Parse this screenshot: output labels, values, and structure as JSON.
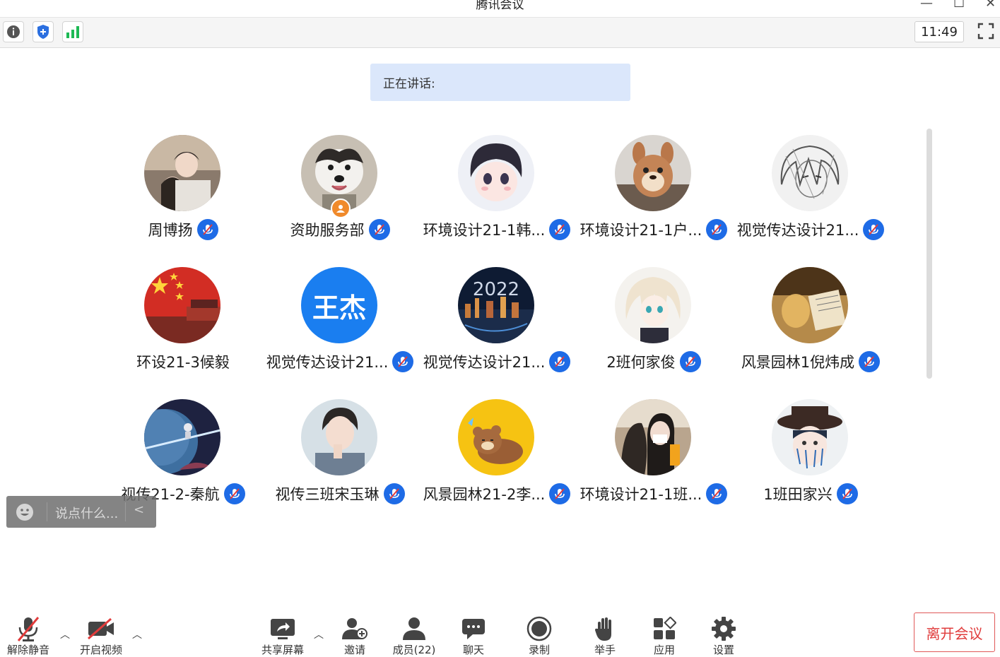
{
  "window": {
    "title": "腾讯会议"
  },
  "toolbar": {
    "time": "11:49"
  },
  "speaking_label": "正在讲话:",
  "participants": [
    {
      "name": "周博扬"
    },
    {
      "name": "资助服务部"
    },
    {
      "name": "环境设计21-1韩..."
    },
    {
      "name": "环境设计21-1户..."
    },
    {
      "name": "视觉传达设计21..."
    },
    {
      "name": "环设21-3候毅"
    },
    {
      "name": "视觉传达设计21...",
      "avatar_text": "王杰"
    },
    {
      "name": "视觉传达设计21..."
    },
    {
      "name": "2班何家俊"
    },
    {
      "name": "风景园林1倪炜成"
    },
    {
      "name": "视传21-2-秦航"
    },
    {
      "name": "视传三班宋玉琳"
    },
    {
      "name": "风景园林21-2李..."
    },
    {
      "name": "环境设计21-1班..."
    },
    {
      "name": "1班田家兴"
    }
  ],
  "chat": {
    "placeholder": "说点什么...",
    "collapse": "<"
  },
  "controls": {
    "unmute": "解除静音",
    "start_video": "开启视频",
    "share_screen": "共享屏幕",
    "invite": "邀请",
    "members": "成员(22)",
    "chat": "聊天",
    "record": "录制",
    "raise_hand": "举手",
    "apps": "应用",
    "settings": "设置",
    "leave": "离开会议"
  },
  "colors": {
    "accent": "#1e6be6",
    "leave": "#e03c3c",
    "speaking_bg": "#dbe7fb"
  }
}
